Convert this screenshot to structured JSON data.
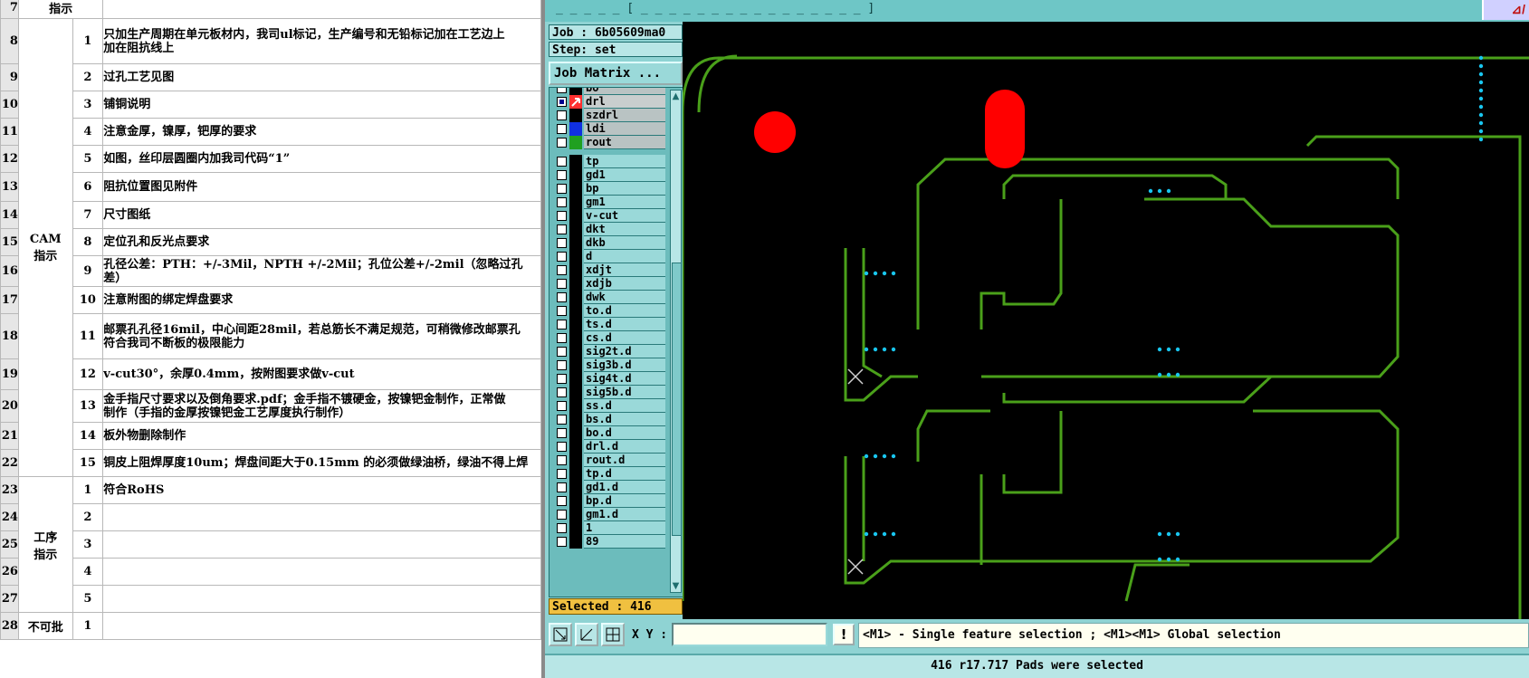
{
  "sheet": {
    "rows": [
      {
        "row": "7",
        "cat": "指示",
        "num": "",
        "text": ""
      },
      {
        "row": "8",
        "num": "1",
        "text": "只加生产周期在单元板材内，我司ul标记，生产编号和无铅标记加在工艺边上",
        "text2": "加在阻抗线上"
      },
      {
        "row": "9",
        "num": "2",
        "text": "过孔工艺见图"
      },
      {
        "row": "10",
        "num": "3",
        "text": "铺铜说明"
      },
      {
        "row": "11",
        "num": "4",
        "text": "注意金厚，镍厚，钯厚的要求"
      },
      {
        "row": "12",
        "num": "5",
        "text": "如图，丝印层圆圈内加我司代码“1”"
      },
      {
        "row": "13",
        "num": "6",
        "text": "阻抗位置图见附件"
      },
      {
        "row": "14",
        "num": "7",
        "text": "尺寸图纸"
      },
      {
        "row": "15",
        "num": "8",
        "text": "定位孔和反光点要求"
      },
      {
        "row": "16",
        "num": "9",
        "text": "孔径公差：PTH：+/-3Mil，NPTH  +/-2Mil；孔位公差+/-2mil（忽略过孔",
        "text2": "差）"
      },
      {
        "row": "17",
        "num": "10",
        "text": "注意附图的绑定焊盘要求"
      },
      {
        "row": "18",
        "num": "11",
        "text": "邮票孔孔径16mil，中心间距28mil，若总筋长不满足规范，可稍微修改邮票孔",
        "text2": "符合我司不断板的极限能力"
      },
      {
        "row": "19",
        "num": "12",
        "text": "v-cut30°，余厚0.4mm，按附图要求做v-cut"
      },
      {
        "row": "20",
        "num": "13",
        "text": "金手指尺寸要求以及倒角要求.pdf；金手指不镀硬金，按镍钯金制作，正常做",
        "text2": "制作（手指的金厚按镍钯金工艺厚度执行制作）"
      },
      {
        "row": "21",
        "num": "14",
        "text": "板外物删除制作"
      },
      {
        "row": "22",
        "num": "15",
        "text": "铜皮上阻焊厚度10um；焊盘间距大于0.15mm 的必须做绿油桥，绿油不得上焊"
      },
      {
        "row": "23",
        "num": "1",
        "text": "符合RoHS"
      },
      {
        "row": "24",
        "num": "2",
        "text": ""
      },
      {
        "row": "25",
        "num": "3",
        "text": ""
      },
      {
        "row": "26",
        "num": "4",
        "text": ""
      },
      {
        "row": "27",
        "num": "5",
        "text": ""
      },
      {
        "row": "28",
        "num": "1",
        "text": ""
      }
    ],
    "cam_category": "CAM\n指示",
    "process_category": "工序\n指示",
    "red_category": "不可批"
  },
  "app": {
    "title": "_ _ _ _  _  [ _ _ _  _ _ _ _ _ _  _ _  _ _ _  _ _  ]",
    "job_label": "Job : 6b05609ma0",
    "step_label": "Step: set",
    "job_matrix_button": "Job Matrix ...",
    "board_layers": [
      {
        "name": "bo",
        "color": "#000000"
      },
      {
        "name": "drl",
        "color": "#000000",
        "checked": true,
        "active": true
      },
      {
        "name": "szdrl",
        "color": "#000000"
      },
      {
        "name": "ldi",
        "color": "#1030e0"
      },
      {
        "name": "rout",
        "color": "#20a020"
      }
    ],
    "misc_layers": [
      "tp",
      "gd1",
      "bp",
      "gm1",
      "v-cut",
      "dkt",
      "dkb",
      "d",
      "xdjt",
      "xdjb",
      "dwk",
      "to.d",
      "ts.d",
      "cs.d",
      "sig2t.d",
      "sig3b.d",
      "sig4t.d",
      "sig5b.d",
      "ss.d",
      "bs.d",
      "bo.d",
      "drl.d",
      "rout.d",
      "tp.d",
      "gd1.d",
      "bp.d",
      "gm1.d",
      "1",
      "89"
    ],
    "selected_label": "Selected : 416",
    "xy_label": "X Y :",
    "xy_value": "",
    "excl_label": "!",
    "hint": "<M1> - Single feature selection ; <M1><M1> Global selection",
    "status": "416 r17.717 Pads were selected",
    "colors": {
      "board_outline": "#4aa01a",
      "pad": "#ff0000",
      "selected_pad": "#19c6f0",
      "background": "#000000"
    }
  }
}
